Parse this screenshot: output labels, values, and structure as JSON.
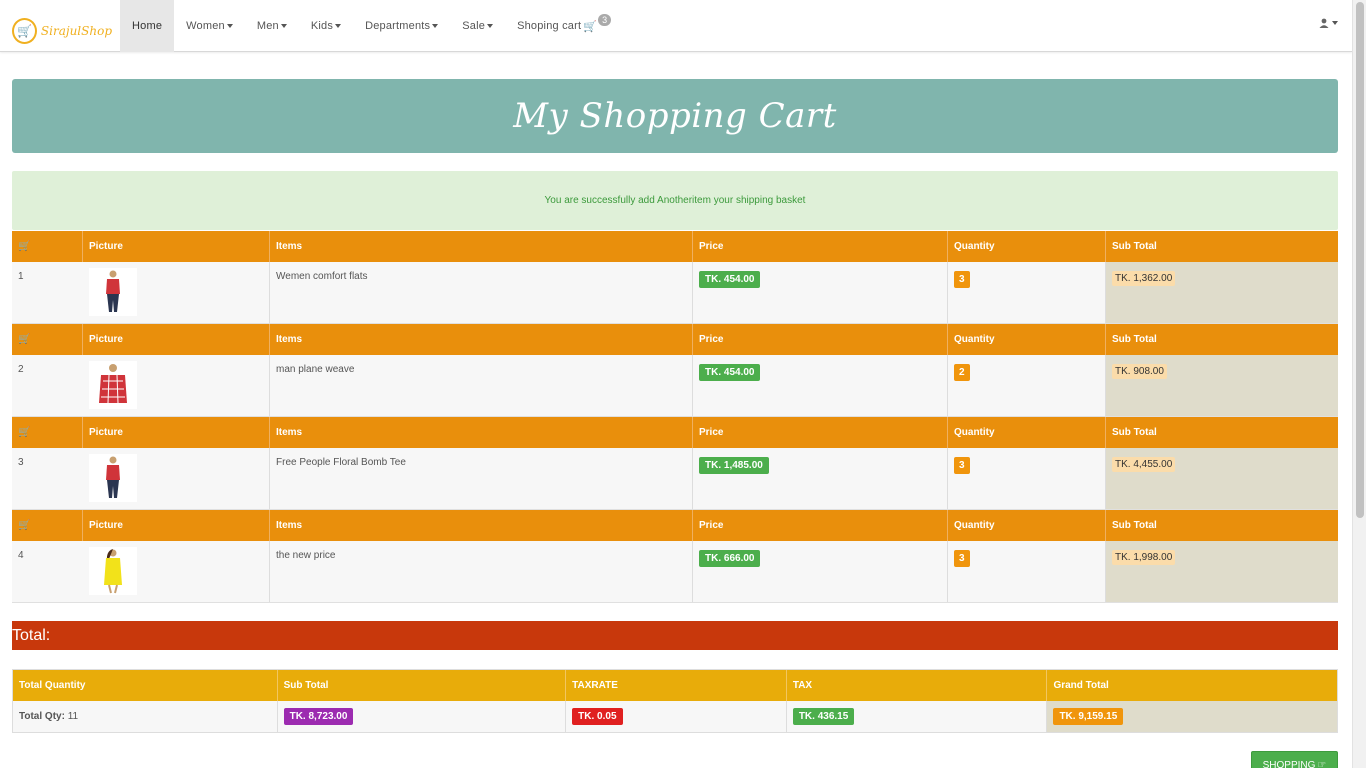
{
  "navbar": {
    "brand": "SirajulShop",
    "items": [
      {
        "label": "Home",
        "active": true,
        "dropdown": false
      },
      {
        "label": "Women",
        "dropdown": true
      },
      {
        "label": "Men",
        "dropdown": true
      },
      {
        "label": "Kids",
        "dropdown": true
      },
      {
        "label": "Departments",
        "dropdown": true
      },
      {
        "label": "Sale",
        "dropdown": true
      }
    ],
    "cart_label": "Shoping cart",
    "cart_count": "3",
    "user_icon": "user-icon"
  },
  "banner": {
    "title": "My Shopping Cart"
  },
  "alert": {
    "text": "You are successfully add Anotheritem your shipping basket"
  },
  "cart": {
    "headers": {
      "picture": "Picture",
      "items": "Items",
      "price": "Price",
      "quantity": "Quantity",
      "subtotal": "Sub Total"
    },
    "rows": [
      {
        "index": "1",
        "item": "Wemen comfort flats",
        "price": "TK. 454.00",
        "qty": "3",
        "subtotal": "TK. 1,362.00",
        "image": "woman-plaid-shirt"
      },
      {
        "index": "2",
        "item": "man plane weave",
        "price": "TK. 454.00",
        "qty": "2",
        "subtotal": "TK. 908.00",
        "image": "man-plaid-shirt"
      },
      {
        "index": "3",
        "item": "Free People Floral Bomb Tee",
        "price": "TK. 1,485.00",
        "qty": "3",
        "subtotal": "TK. 4,455.00",
        "image": "woman-plaid-shirt"
      },
      {
        "index": "4",
        "item": "the new price",
        "price": "TK. 666.00",
        "qty": "3",
        "subtotal": "TK. 1,998.00",
        "image": "woman-yellow-top"
      }
    ]
  },
  "total": {
    "title": "Total:",
    "headers": {
      "qty": "Total Quantity",
      "subtotal": "Sub Total",
      "taxrate": "TAXRATE",
      "tax": "TAX",
      "grand": "Grand Total"
    },
    "qty_label": "Total Qty:",
    "qty_value": "11",
    "subtotal": "TK. 8,723.00",
    "taxrate": "TK. 0.05",
    "tax": "TK. 436.15",
    "grand": "TK. 9,159.15"
  },
  "shopping_button": "SHOPPING",
  "colors": {
    "header_orange": "#e98f0c",
    "banner": "#80b5ad",
    "total_bar": "#c8380c",
    "summary_head": "#e8ac0a"
  }
}
